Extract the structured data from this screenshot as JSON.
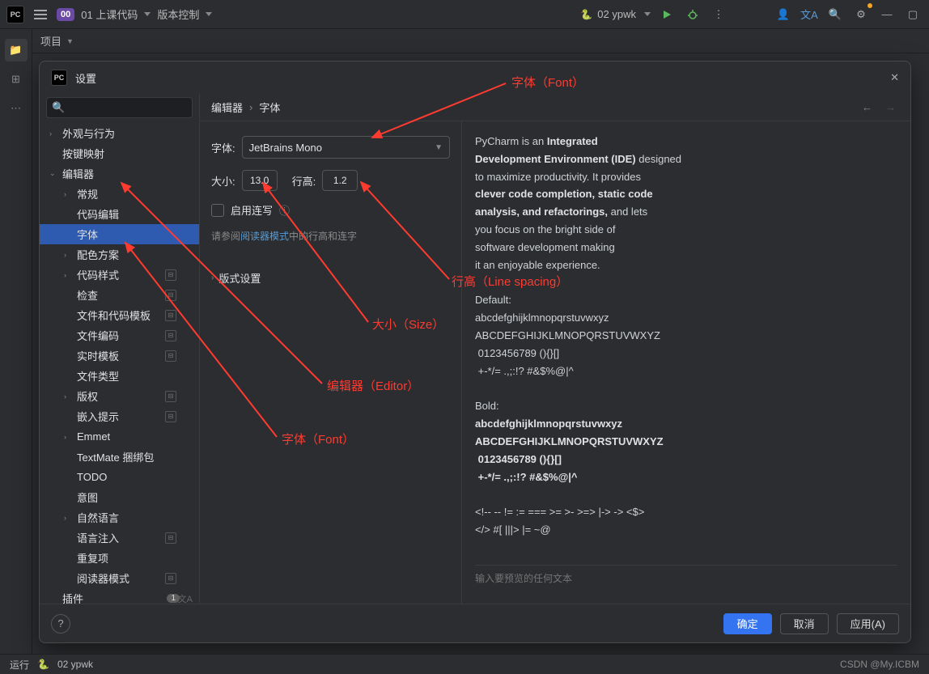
{
  "topbar": {
    "project_badge": "00",
    "project_name": "01 上课代码",
    "vcs": "版本控制",
    "run_config": "02 ypwk"
  },
  "project_panel": {
    "title": "项目"
  },
  "settings": {
    "title": "设置",
    "search_placeholder": "",
    "breadcrumb": {
      "a": "编辑器",
      "sep": "›",
      "b": "字体"
    },
    "form": {
      "font_label": "字体:",
      "font_value": "JetBrains Mono",
      "size_label": "大小:",
      "size_value": "13.0",
      "lineheight_label": "行高:",
      "lineheight_value": "1.2",
      "ligatures_label": "启用连写",
      "hint_prefix": "请参阅",
      "hint_link": "阅读器模式",
      "hint_suffix": "中的行高和连字",
      "typography_settings": "版式设置"
    },
    "preview_placeholder": "输入要预览的任何文本",
    "buttons": {
      "ok": "确定",
      "cancel": "取消",
      "apply": "应用(A)"
    },
    "tree": {
      "appearance": "外观与行为",
      "keymap": "按键映射",
      "editor": "编辑器",
      "general": "常规",
      "code_editing": "代码编辑",
      "font": "字体",
      "color_scheme": "配色方案",
      "code_style": "代码样式",
      "inspections": "检查",
      "file_code_templates": "文件和代码模板",
      "file_encodings": "文件编码",
      "live_templates": "实时模板",
      "file_types": "文件类型",
      "copyright": "版权",
      "inlay_hints": "嵌入提示",
      "emmet": "Emmet",
      "textmate": "TextMate 捆绑包",
      "todo": "TODO",
      "intentions": "意图",
      "natural_languages": "自然语言",
      "language_injections": "语言注入",
      "duplicates": "重复项",
      "reader_mode": "阅读器模式",
      "plugins": "插件",
      "plugins_badge": "1"
    }
  },
  "preview": {
    "p1a": "PyCharm is an ",
    "p1b": "Integrated",
    "p2a": "Development Environment (IDE)",
    "p2b": " designed",
    "p3": "to maximize productivity. It provides",
    "p4": "clever code completion, static code",
    "p5a": "analysis, and refactorings,",
    "p5b": " and lets",
    "p6": "you focus on the bright side of",
    "p7": "software development making",
    "p8": "it an enjoyable experience.",
    "def_label": "Default:",
    "alpha_low": "abcdefghijklmnopqrstuvwxyz",
    "alpha_up": "ABCDEFGHIJKLMNOPQRSTUVWXYZ",
    "nums": " 0123456789 (){}[]",
    "syms": " +-*/= .,;:!? #&$%@|^",
    "bold_label": "Bold:",
    "ops": "<!-- -- != := === >= >- >=> |-> -> <$>",
    "ops2": "</> #[ |||> |= ~@"
  },
  "status": {
    "run": "运行",
    "script": "02 ypwk",
    "watermark": "CSDN @My.ICBM"
  },
  "annotations": {
    "font_top": "字体（Font）",
    "line_spacing": "行高（Line spacing）",
    "size": "大小（Size）",
    "editor": "编辑器（Editor）",
    "font_side": "字体（Font）"
  }
}
